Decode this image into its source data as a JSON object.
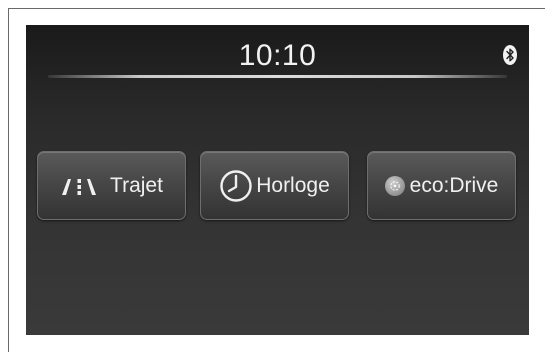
{
  "status_bar": {
    "time": "10:10",
    "bluetooth_icon": "bluetooth-icon"
  },
  "menu": {
    "buttons": [
      {
        "label": "Trajet",
        "icon": "road-lanes-icon"
      },
      {
        "label": "Horloge",
        "icon": "clock-icon"
      },
      {
        "label": "eco:Drive",
        "icon": "eco-drive-icon"
      }
    ]
  },
  "colors": {
    "screen_background": "#2a2a2a",
    "text": "#f0f0f0",
    "button_face": "#474747"
  }
}
